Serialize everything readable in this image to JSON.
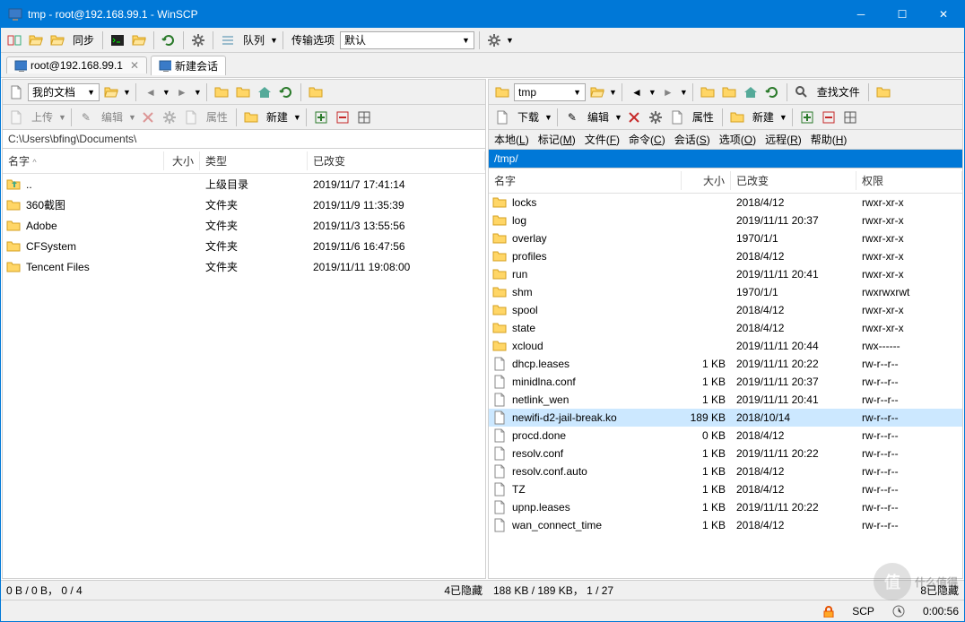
{
  "window": {
    "title": "tmp - root@192.168.99.1 - WinSCP"
  },
  "toolbar1": {
    "sync": "同步",
    "queue": "队列",
    "transfer_label": "传输选项",
    "transfer_value": "默认"
  },
  "tabs": {
    "session": "root@192.168.99.1",
    "new_session": "新建会话"
  },
  "left": {
    "bookmark": "我的文档",
    "upload": "上传",
    "edit": "编辑",
    "props": "属性",
    "new": "新建",
    "path": "C:\\Users\\bfing\\Documents\\",
    "cols": {
      "name": "名字",
      "size": "大小",
      "type": "类型",
      "changed": "已改变"
    },
    "rows": [
      {
        "name": "..",
        "type": "上级目录",
        "changed": "2019/11/7  17:41:14",
        "icon": "up"
      },
      {
        "name": "360截图",
        "type": "文件夹",
        "changed": "2019/11/9  11:35:39",
        "icon": "folder"
      },
      {
        "name": "Adobe",
        "type": "文件夹",
        "changed": "2019/11/3  13:55:56",
        "icon": "folder"
      },
      {
        "name": "CFSystem",
        "type": "文件夹",
        "changed": "2019/11/6  16:47:56",
        "icon": "folder"
      },
      {
        "name": "Tencent Files",
        "type": "文件夹",
        "changed": "2019/11/11  19:08:00",
        "icon": "folder"
      }
    ],
    "status": "0 B / 0 B， 0 / 4",
    "hidden": "4已隐藏"
  },
  "right": {
    "bookmark": "tmp",
    "download": "下载",
    "edit": "编辑",
    "props": "属性",
    "new": "新建",
    "find": "查找文件",
    "menu": {
      "local": "本地(L)",
      "mark": "标记(M)",
      "files": "文件(F)",
      "cmd": "命令(C)",
      "session": "会话(S)",
      "options": "选项(O)",
      "remote": "远程(R)",
      "help": "帮助(H)"
    },
    "path": "/tmp/",
    "cols": {
      "name": "名字",
      "size": "大小",
      "changed": "已改变",
      "perm": "权限"
    },
    "rows": [
      {
        "name": "locks",
        "size": "",
        "changed": "2018/4/12",
        "perm": "rwxr-xr-x",
        "icon": "folder"
      },
      {
        "name": "log",
        "size": "",
        "changed": "2019/11/11 20:37",
        "perm": "rwxr-xr-x",
        "icon": "folder"
      },
      {
        "name": "overlay",
        "size": "",
        "changed": "1970/1/1",
        "perm": "rwxr-xr-x",
        "icon": "folder"
      },
      {
        "name": "profiles",
        "size": "",
        "changed": "2018/4/12",
        "perm": "rwxr-xr-x",
        "icon": "folder"
      },
      {
        "name": "run",
        "size": "",
        "changed": "2019/11/11 20:41",
        "perm": "rwxr-xr-x",
        "icon": "folder"
      },
      {
        "name": "shm",
        "size": "",
        "changed": "1970/1/1",
        "perm": "rwxrwxrwt",
        "icon": "folder"
      },
      {
        "name": "spool",
        "size": "",
        "changed": "2018/4/12",
        "perm": "rwxr-xr-x",
        "icon": "folder"
      },
      {
        "name": "state",
        "size": "",
        "changed": "2018/4/12",
        "perm": "rwxr-xr-x",
        "icon": "folder"
      },
      {
        "name": "xcloud",
        "size": "",
        "changed": "2019/11/11 20:44",
        "perm": "rwx------",
        "icon": "folder"
      },
      {
        "name": "dhcp.leases",
        "size": "1 KB",
        "changed": "2019/11/11 20:22",
        "perm": "rw-r--r--",
        "icon": "file"
      },
      {
        "name": "minidlna.conf",
        "size": "1 KB",
        "changed": "2019/11/11 20:37",
        "perm": "rw-r--r--",
        "icon": "file"
      },
      {
        "name": "netlink_wen",
        "size": "1 KB",
        "changed": "2019/11/11 20:41",
        "perm": "rw-r--r--",
        "icon": "file"
      },
      {
        "name": "newifi-d2-jail-break.ko",
        "size": "189 KB",
        "changed": "2018/10/14",
        "perm": "rw-r--r--",
        "icon": "file",
        "selected": true
      },
      {
        "name": "procd.done",
        "size": "0 KB",
        "changed": "2018/4/12",
        "perm": "rw-r--r--",
        "icon": "file"
      },
      {
        "name": "resolv.conf",
        "size": "1 KB",
        "changed": "2019/11/11 20:22",
        "perm": "rw-r--r--",
        "icon": "file"
      },
      {
        "name": "resolv.conf.auto",
        "size": "1 KB",
        "changed": "2018/4/12",
        "perm": "rw-r--r--",
        "icon": "file"
      },
      {
        "name": "TZ",
        "size": "1 KB",
        "changed": "2018/4/12",
        "perm": "rw-r--r--",
        "icon": "file"
      },
      {
        "name": "upnp.leases",
        "size": "1 KB",
        "changed": "2019/11/11 20:22",
        "perm": "rw-r--r--",
        "icon": "file"
      },
      {
        "name": "wan_connect_time",
        "size": "1 KB",
        "changed": "2018/4/12",
        "perm": "rw-r--r--",
        "icon": "file"
      }
    ],
    "status": "188 KB / 189 KB， 1 / 27",
    "hidden": "8已隐藏"
  },
  "bottom": {
    "proto": "SCP",
    "time": "0:00:56"
  },
  "watermark": "什么值得"
}
